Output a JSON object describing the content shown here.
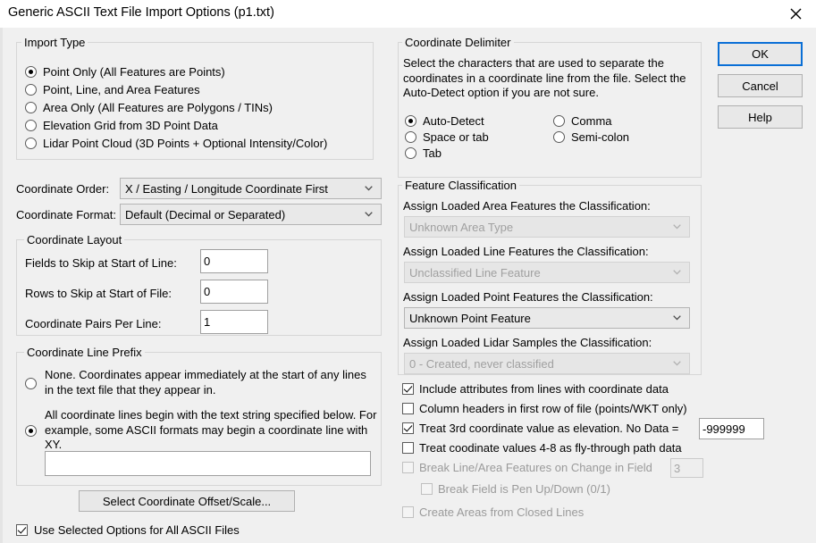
{
  "window": {
    "title": "Generic ASCII Text File Import Options (p1.txt)",
    "close_icon": "close-icon"
  },
  "import_type": {
    "legend": "Import Type",
    "options": [
      {
        "label": "Point Only (All Features are Points)",
        "checked": true
      },
      {
        "label": "Point, Line, and Area Features",
        "checked": false
      },
      {
        "label": "Area Only (All Features are Polygons / TINs)",
        "checked": false
      },
      {
        "label": "Elevation Grid from 3D Point Data",
        "checked": false
      },
      {
        "label": "Lidar Point Cloud (3D Points + Optional Intensity/Color)",
        "checked": false
      }
    ]
  },
  "coordinate_order": {
    "label": "Coordinate Order:",
    "value": "X / Easting / Longitude Coordinate First"
  },
  "coordinate_format": {
    "label": "Coordinate Format:",
    "value": "Default (Decimal or Separated)"
  },
  "coordinate_layout": {
    "legend": "Coordinate Layout",
    "fields_to_skip": {
      "label": "Fields to Skip at Start of Line:",
      "value": "0"
    },
    "rows_to_skip": {
      "label": "Rows to Skip at Start of File:",
      "value": "0"
    },
    "pairs_per_line": {
      "label": "Coordinate Pairs Per Line:",
      "value": "1"
    }
  },
  "coordinate_line_prefix": {
    "legend": "Coordinate Line Prefix",
    "option_none": {
      "label": "None. Coordinates appear immediately at the start of any lines in the text file that they appear in.",
      "checked": false
    },
    "option_prefix": {
      "label": "All coordinate lines begin with the text string specified below. For example, some ASCII formats may begin a coordinate line with XY.",
      "checked": true
    },
    "prefix_value": ""
  },
  "offset_scale_button": {
    "label": "Select Coordinate Offset/Scale..."
  },
  "use_selected_options": {
    "label": "Use Selected Options for All ASCII Files",
    "checked": true
  },
  "coordinate_delimiter": {
    "legend": "Coordinate Delimiter",
    "description": "Select the characters that are used to separate the coordinates in a coordinate line from the file. Select the Auto-Detect option if you are not sure.",
    "options_left": [
      {
        "label": "Auto-Detect",
        "checked": true
      },
      {
        "label": "Space or tab",
        "checked": false
      },
      {
        "label": "Tab",
        "checked": false
      }
    ],
    "options_right": [
      {
        "label": "Comma",
        "checked": false
      },
      {
        "label": "Semi-colon",
        "checked": false
      }
    ]
  },
  "feature_classification": {
    "legend": "Feature Classification",
    "area": {
      "label": "Assign Loaded Area Features the Classification:",
      "value": "Unknown Area Type",
      "enabled": false
    },
    "line": {
      "label": "Assign Loaded Line Features the Classification:",
      "value": "Unclassified Line Feature",
      "enabled": false
    },
    "point": {
      "label": "Assign Loaded Point Features the Classification:",
      "value": "Unknown Point Feature",
      "enabled": true
    },
    "lidar": {
      "label": "Assign Loaded Lidar Samples the Classification:",
      "value": "0 - Created, never classified",
      "enabled": false
    }
  },
  "options_checkboxes": {
    "include_attributes": {
      "label": "Include attributes from lines with coordinate data",
      "checked": true,
      "enabled": true
    },
    "column_headers": {
      "label": "Column headers in first row of file (points/WKT only)",
      "checked": false,
      "enabled": true
    },
    "treat_3rd_elevation": {
      "label": "Treat 3rd coordinate value as elevation. No Data =",
      "checked": true,
      "enabled": true,
      "nodata_value": "-999999"
    },
    "fly_through": {
      "label": "Treat coodinate values 4-8 as fly-through path data",
      "checked": false,
      "enabled": true
    },
    "break_line_area": {
      "label": "Break Line/Area Features on Change in Field",
      "checked": false,
      "enabled": false,
      "field_value": "3"
    },
    "break_field_pen": {
      "label": "Break Field is Pen Up/Down (0/1)",
      "checked": false,
      "enabled": false
    },
    "create_areas": {
      "label": "Create Areas from Closed Lines",
      "checked": false,
      "enabled": false
    }
  },
  "buttons": {
    "ok": "OK",
    "cancel": "Cancel",
    "help": "Help"
  }
}
